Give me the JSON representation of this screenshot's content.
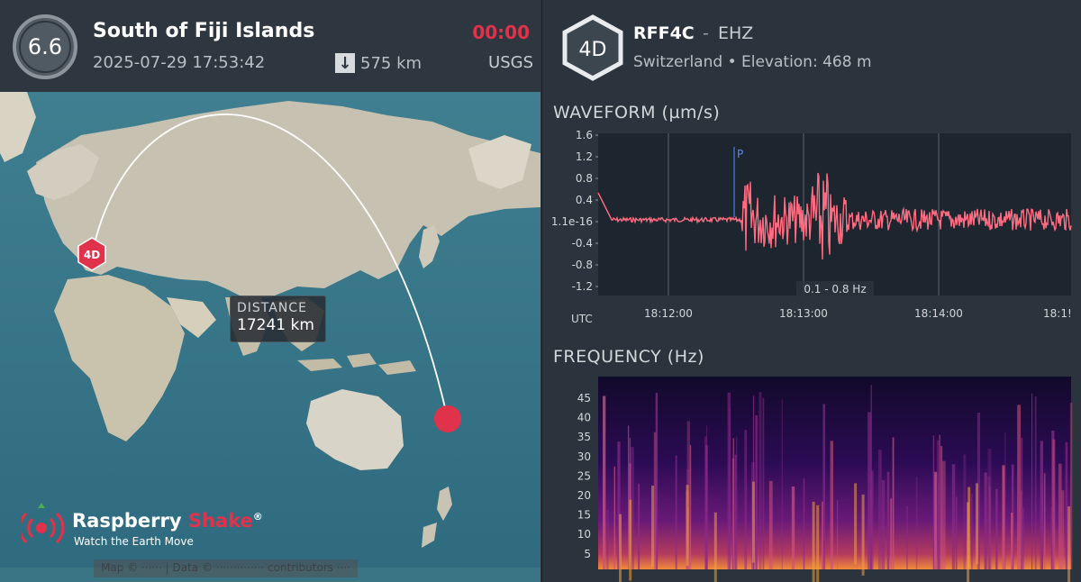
{
  "event": {
    "magnitude": "6.6",
    "title": "South of Fiji Islands",
    "datetime": "2025-07-29 17:53:42",
    "depth": "575 km",
    "elapsed": "00:00",
    "source": "USGS"
  },
  "map": {
    "station_marker": "4D",
    "distance_label": "DISTANCE",
    "distance_value": "17241 km",
    "logo_name_a": "Raspberry",
    "logo_name_b": "Shake",
    "logo_reg": "®",
    "logo_tagline": "Watch the Earth Move",
    "attribution": "Map © ······ | Data © ·············· contributors ····"
  },
  "station": {
    "badge": "4D",
    "code": "RFF4C",
    "separator": "-",
    "channel": "EHZ",
    "meta": "Switzerland • Elevation: 468 m"
  },
  "waveform": {
    "title": "WAVEFORM (µm/s)",
    "y_ticks": [
      "1.6",
      "1.2",
      "0.8",
      "0.4",
      "1.1e-16",
      "-0.4",
      "-0.8",
      "-1.2"
    ],
    "x_ticks": [
      "18:12:00",
      "18:13:00",
      "18:14:00",
      "18:1!"
    ],
    "x_unit": "UTC",
    "p_marker": "P",
    "filter": "0.1 - 0.8 Hz",
    "line_color": "#ff6b81"
  },
  "frequency": {
    "title": "FREQUENCY (Hz)",
    "y_ticks": [
      "45",
      "40",
      "35",
      "30",
      "25",
      "20",
      "15",
      "10",
      "5"
    ]
  },
  "colors": {
    "accent_red": "#e0324a",
    "panel_bg": "#2b343c"
  }
}
